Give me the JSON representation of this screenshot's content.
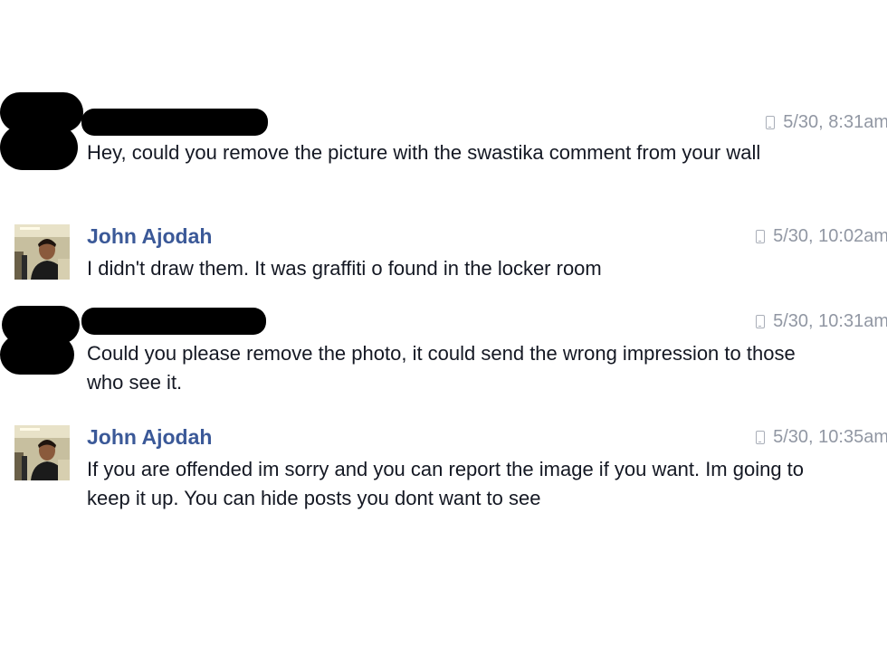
{
  "messages": [
    {
      "sender": "",
      "sender_redacted": true,
      "time": "5/30, 8:31am",
      "text": "Hey, could you remove the picture with the swastika comment from your wall"
    },
    {
      "sender": "John Ajodah",
      "sender_redacted": false,
      "time": "5/30, 10:02am",
      "text": "I didn't draw them. It was graffiti o found in the locker room"
    },
    {
      "sender": "",
      "sender_redacted": true,
      "time": "5/30, 10:31am",
      "text": "Could you please remove the photo, it could send the wrong impression to those who see it."
    },
    {
      "sender": "John Ajodah",
      "sender_redacted": false,
      "time": "5/30, 10:35am",
      "text": "If you are offended im sorry and you can report the image if you want. Im going to keep it up. You can hide posts you dont want to see"
    }
  ],
  "icons": {
    "sent_from": "mobile-phone-icon"
  },
  "colors": {
    "sender_name": "#3b5998",
    "timestamp": "#9197a3",
    "message_text": "#141823",
    "redaction": "#000000"
  }
}
